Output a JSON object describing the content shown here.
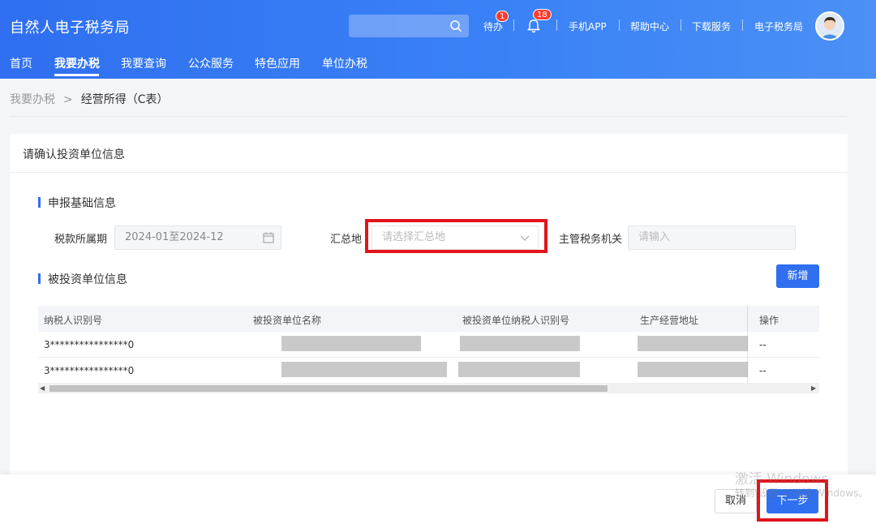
{
  "header": {
    "app_title": "自然人电子税务局",
    "search_placeholder": "",
    "todo_label": "待办",
    "todo_badge": "1",
    "bell_badge": "18",
    "links": [
      "手机APP",
      "帮助中心",
      "下载服务",
      "电子税务局"
    ]
  },
  "nav": {
    "items": [
      "首页",
      "我要办税",
      "我要查询",
      "公众服务",
      "特色应用",
      "单位办税"
    ],
    "active": "我要办税"
  },
  "breadcrumb": {
    "parent": "我要办税",
    "separator": ">",
    "current": "经营所得（C表）"
  },
  "card": {
    "title": "请确认投资单位信息",
    "section_basic": "申报基础信息",
    "period_label": "税款所属期",
    "period_value": "2024-01至2024-12",
    "summary_label": "汇总地",
    "summary_placeholder": "请选择汇总地",
    "authority_label": "主管税务机关",
    "authority_placeholder": "请输入",
    "section_invested": "被投资单位信息",
    "add_button": "新增"
  },
  "table": {
    "columns": [
      "纳税人识别号",
      "被投资单位名称",
      "被投资单位纳税人识别号",
      "生产经营地址",
      "操作"
    ],
    "rows": [
      {
        "taxpayer_id": "3****************0",
        "operation": "--"
      },
      {
        "taxpayer_id": "3****************0",
        "operation": "--"
      }
    ]
  },
  "footer": {
    "cancel_label": "取消",
    "next_label": "下一步"
  },
  "watermark": {
    "line1": "激活 Windows",
    "line2": "转到\"设置\"以激活 Windows。"
  },
  "colors": {
    "brand_blue": "#2f6ff0",
    "highlight_red": "#e1141c",
    "badge_red": "#ff3b30"
  }
}
